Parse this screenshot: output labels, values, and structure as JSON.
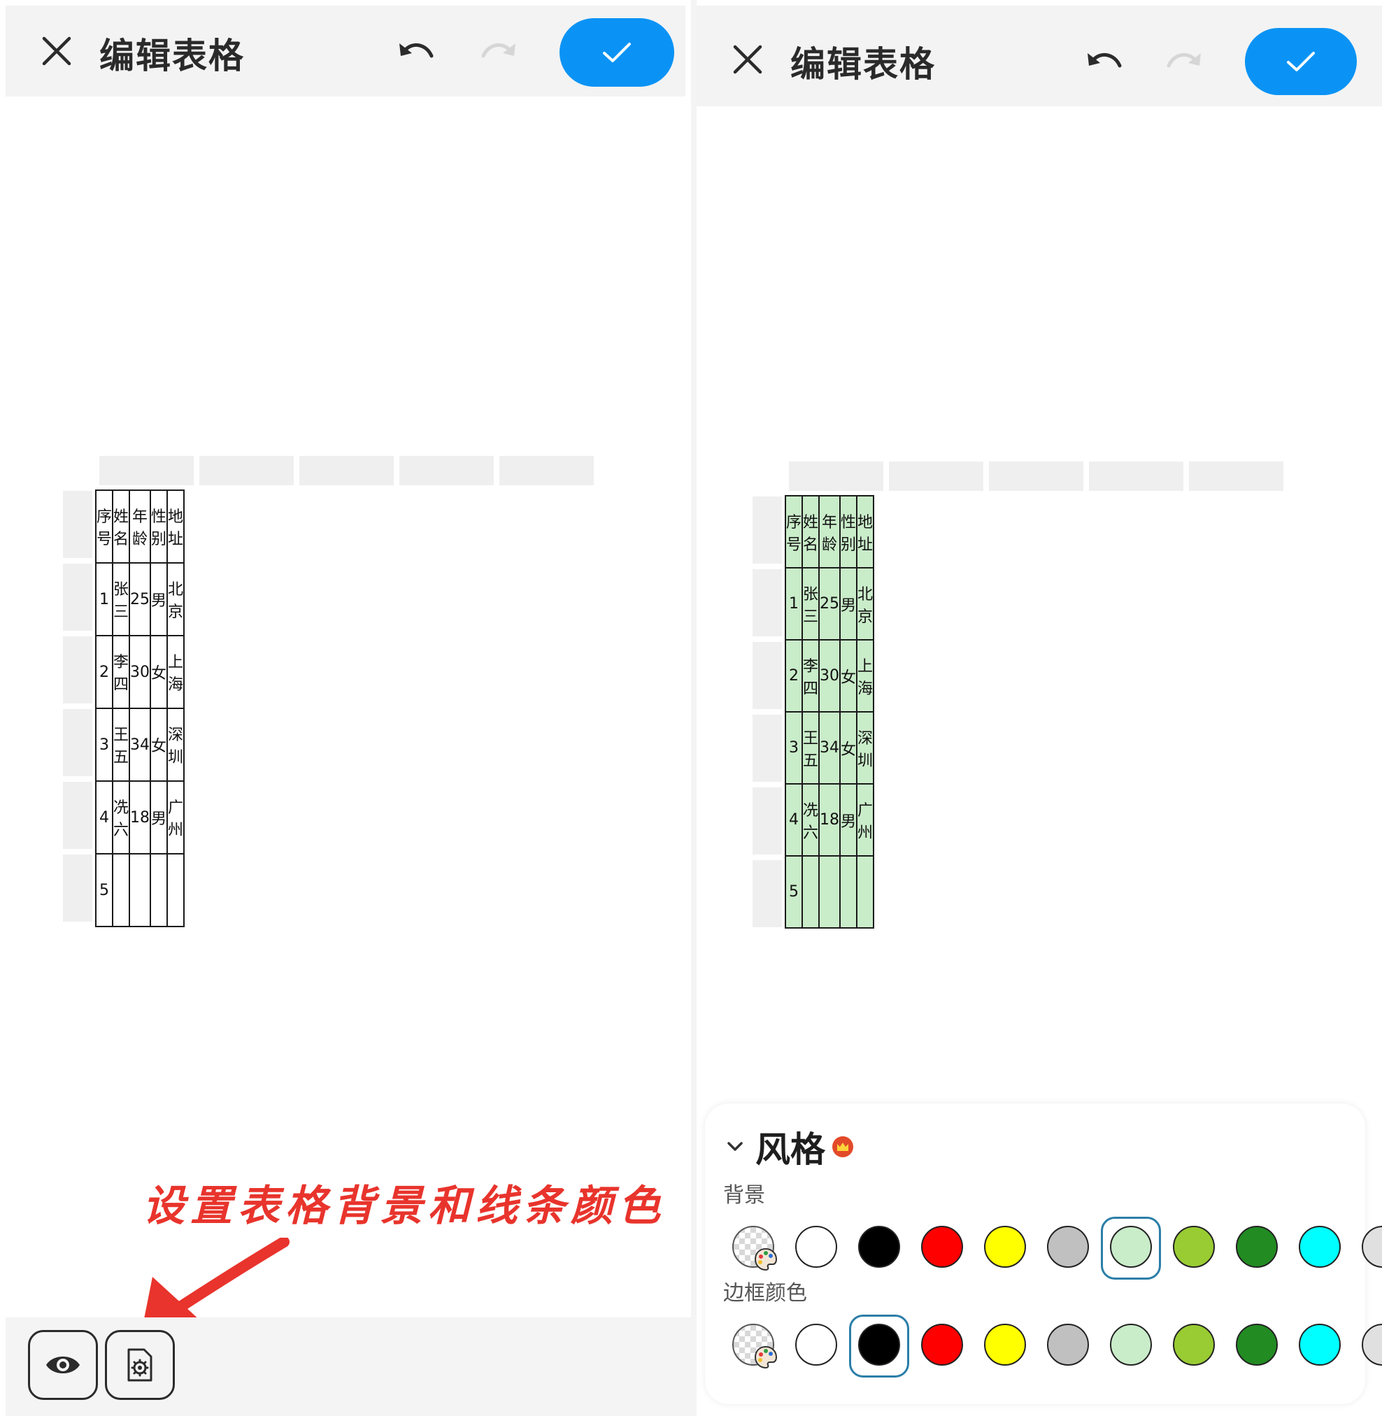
{
  "header": {
    "title": "编辑表格"
  },
  "table": {
    "rows": [
      [
        "序号",
        "姓名",
        "年龄",
        "性别",
        "地址"
      ],
      [
        "1",
        "张三",
        "25",
        "男",
        "北京"
      ],
      [
        "2",
        "李四",
        "30",
        "女",
        "上海"
      ],
      [
        "3",
        "王五",
        "34",
        "女",
        "深圳"
      ],
      [
        "4",
        "冼六",
        "18",
        "男",
        "广州"
      ],
      [
        "5",
        "",
        "",
        "",
        ""
      ]
    ]
  },
  "annotation": "设置表格背景和线条颜色",
  "style_panel": {
    "title": "风格",
    "background_label": "背景",
    "border_label": "边框颜色",
    "swatches": [
      "custom",
      "#ffffff",
      "#000000",
      "#ff0000",
      "#ffff00",
      "#c0c0c0",
      "#c9ecc9",
      "#99cc33",
      "#228b22",
      "#00ffff",
      "#e0e0e0"
    ],
    "background_selected": "#c9ecc9",
    "border_selected": "#000000"
  },
  "colors": {
    "accent": "#0a93f5",
    "annotation": "#e8342c",
    "table_bg_applied": "#c9ecc9"
  }
}
